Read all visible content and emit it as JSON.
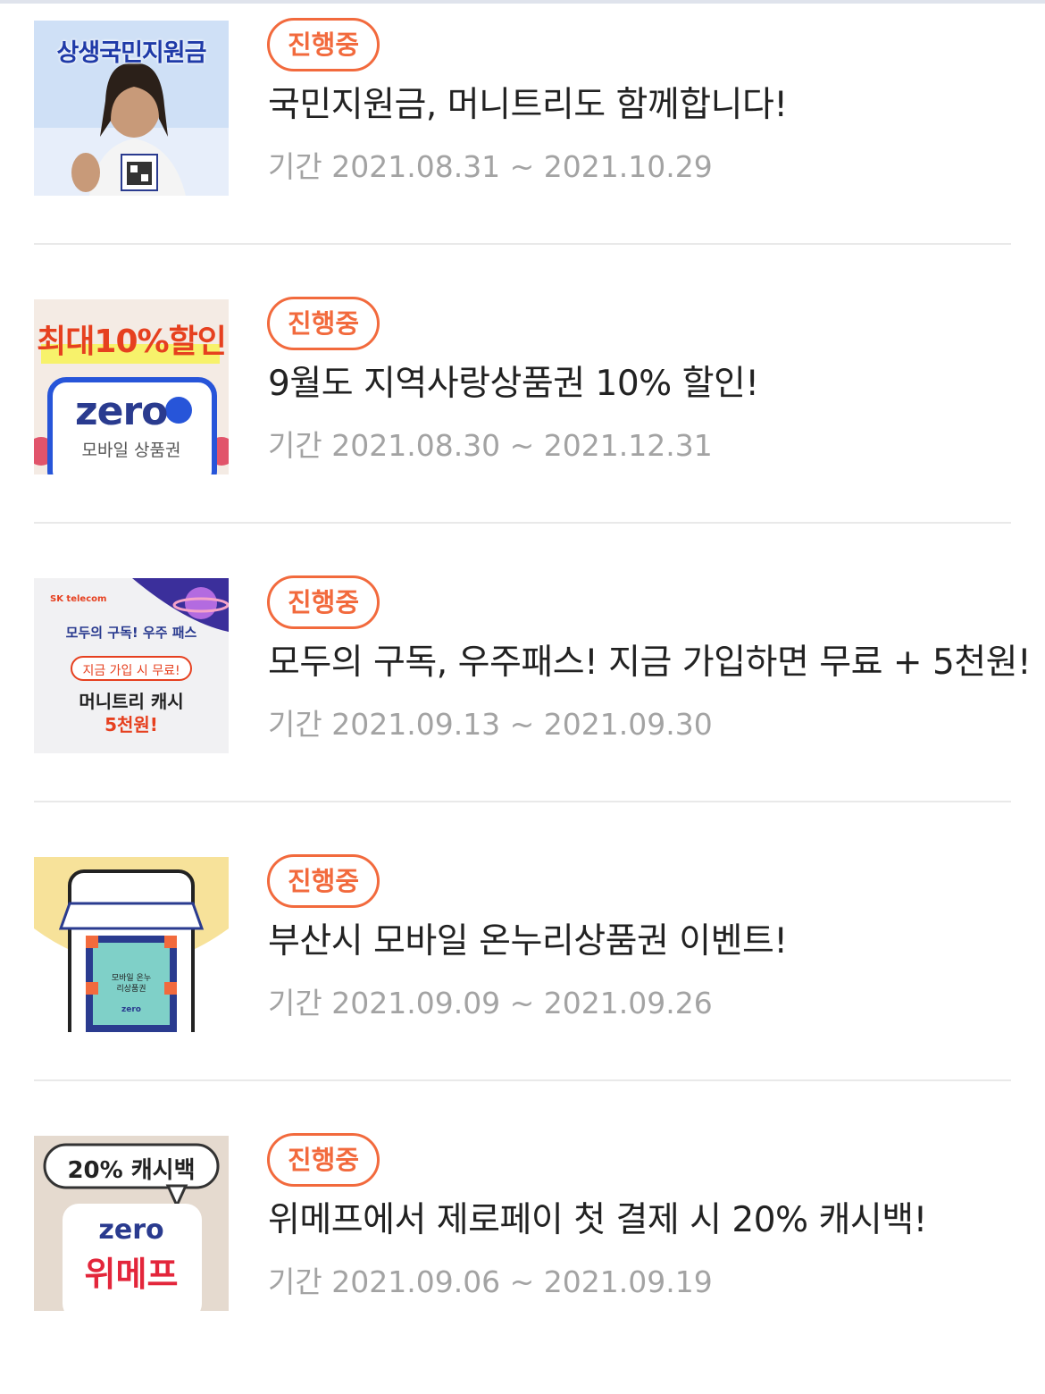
{
  "events": [
    {
      "status": "진행중",
      "title": "국민지원금, 머니트리도 함께합니다!",
      "period_label": "기간",
      "period": "2021.08.31 ~ 2021.10.29",
      "thumb_text": "상생국민지원금"
    },
    {
      "status": "진행중",
      "title": "9월도 지역사랑상품권 10% 할인!",
      "period_label": "기간",
      "period": "2021.08.30 ~ 2021.12.31",
      "thumb_text": "최대10%할인",
      "thumb_sub": "zero",
      "thumb_sub2": "모바일 상품권"
    },
    {
      "status": "진행중",
      "title": "모두의 구독, 우주패스! 지금 가입하면 무료 + 5천원!",
      "period_label": "기간",
      "period": "2021.09.13 ~ 2021.09.30",
      "thumb_text": "모두의 구독! 우주 패스",
      "thumb_sub": "지금 가입 시 무료!",
      "thumb_sub2": "머니트리 캐시",
      "thumb_sub3": "5천원!",
      "thumb_brand": "SK telecom"
    },
    {
      "status": "진행중",
      "title": "부산시 모바일 온누리상품권 이벤트!",
      "period_label": "기간",
      "period": "2021.09.09 ~ 2021.09.26",
      "thumb_text": "모바일 온누리상품권",
      "thumb_sub": "zero"
    },
    {
      "status": "진행중",
      "title": "위메프에서 제로페이 첫 결제 시 20% 캐시백!",
      "period_label": "기간",
      "period": "2021.09.06 ~ 2021.09.19",
      "thumb_text": "20% 캐시백",
      "thumb_sub": "zero",
      "thumb_sub2": "위메프"
    }
  ],
  "colors": {
    "accent": "#f26a3d",
    "title": "#222222",
    "meta": "#a3a3a3",
    "divider": "#e9e9e9"
  }
}
